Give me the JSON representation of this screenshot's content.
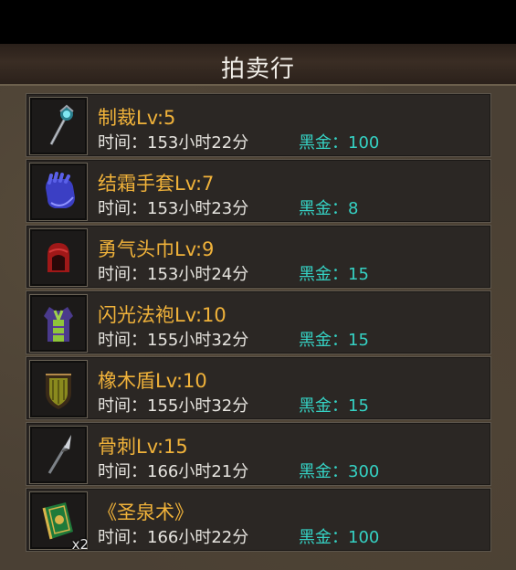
{
  "header": {
    "title": "拍卖行"
  },
  "items": [
    {
      "name": "制裁Lv:5",
      "time": "时间：153小时22分",
      "price": "黑金：100",
      "icon": "staff-icon"
    },
    {
      "name": "结霜手套Lv:7",
      "time": "时间：153小时23分",
      "price": "黑金：8",
      "icon": "glove-icon"
    },
    {
      "name": "勇气头巾Lv:9",
      "time": "时间：153小时24分",
      "price": "黑金：15",
      "icon": "hood-icon"
    },
    {
      "name": "闪光法袍Lv:10",
      "time": "时间：155小时32分",
      "price": "黑金：15",
      "icon": "robe-icon"
    },
    {
      "name": "橡木盾Lv:10",
      "time": "时间：155小时32分",
      "price": "黑金：15",
      "icon": "shield-icon"
    },
    {
      "name": "骨刺Lv:15",
      "time": "时间：166小时21分",
      "price": "黑金：300",
      "icon": "spear-icon"
    },
    {
      "name": "《圣泉术》",
      "time": "时间：166小时22分",
      "price": "黑金：100",
      "icon": "book-icon",
      "quantity": "x2"
    }
  ]
}
